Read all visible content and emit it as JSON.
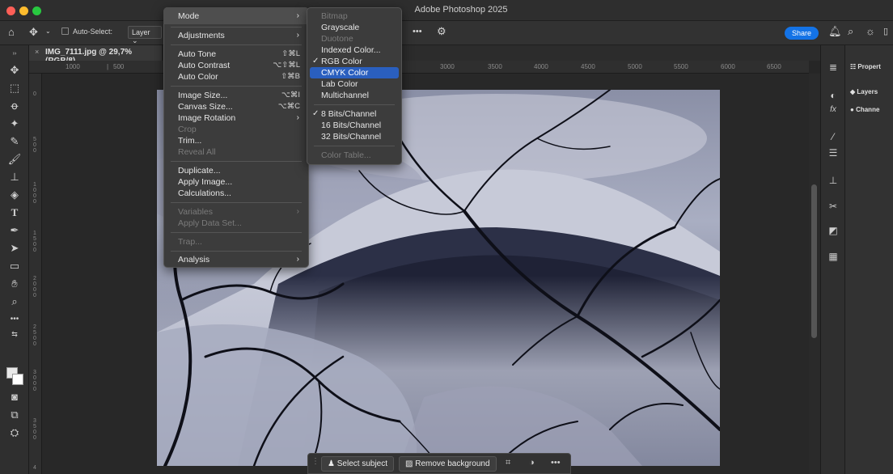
{
  "window": {
    "app_title": "Adobe Photoshop 2025"
  },
  "options_bar": {
    "auto_select_label": "Auto-Select:",
    "auto_select_value": "Layer",
    "more_label": "•••",
    "share_label": "Share"
  },
  "document": {
    "tab_title": "IMG_7111.jpg @ 29,7% (RGB/8)"
  },
  "rulers": {
    "horizontal": [
      "1000",
      "500",
      "3000",
      "3500",
      "4000",
      "4500",
      "5000",
      "5500",
      "6000",
      "6500"
    ],
    "vertical": [
      "0",
      "500",
      "1000",
      "1500",
      "2000",
      "2500",
      "3000",
      "3500",
      "4"
    ]
  },
  "image_menu": {
    "header": "Mode",
    "items": {
      "adjustments": "Adjustments",
      "auto_tone": "Auto Tone",
      "auto_tone_sc": "⇧⌘L",
      "auto_contrast": "Auto Contrast",
      "auto_contrast_sc": "⌥⇧⌘L",
      "auto_color": "Auto Color",
      "auto_color_sc": "⇧⌘B",
      "image_size": "Image Size...",
      "image_size_sc": "⌥⌘I",
      "canvas_size": "Canvas Size...",
      "canvas_size_sc": "⌥⌘C",
      "image_rotation": "Image Rotation",
      "crop": "Crop",
      "trim": "Trim...",
      "reveal_all": "Reveal All",
      "duplicate": "Duplicate...",
      "apply_image": "Apply Image...",
      "calculations": "Calculations...",
      "variables": "Variables",
      "apply_data_set": "Apply Data Set...",
      "trap": "Trap...",
      "analysis": "Analysis"
    }
  },
  "mode_submenu": {
    "bitmap": "Bitmap",
    "grayscale": "Grayscale",
    "duotone": "Duotone",
    "indexed_color": "Indexed Color...",
    "rgb_color": "RGB Color",
    "cmyk_color": "CMYK Color",
    "lab_color": "Lab Color",
    "multichannel": "Multichannel",
    "bits8": "8 Bits/Channel",
    "bits16": "16 Bits/Channel",
    "bits32": "32 Bits/Channel",
    "color_table": "Color Table..."
  },
  "right_panel": {
    "properties": "Propert",
    "layers": "Layers",
    "channels": "Channe"
  },
  "context_bar": {
    "select_subject": "Select subject",
    "remove_background": "Remove background",
    "more": "•••"
  },
  "colors": {
    "menu_bg": "#3c3c3c",
    "highlight": "#2a5fbf",
    "share_blue": "#1473e6"
  }
}
